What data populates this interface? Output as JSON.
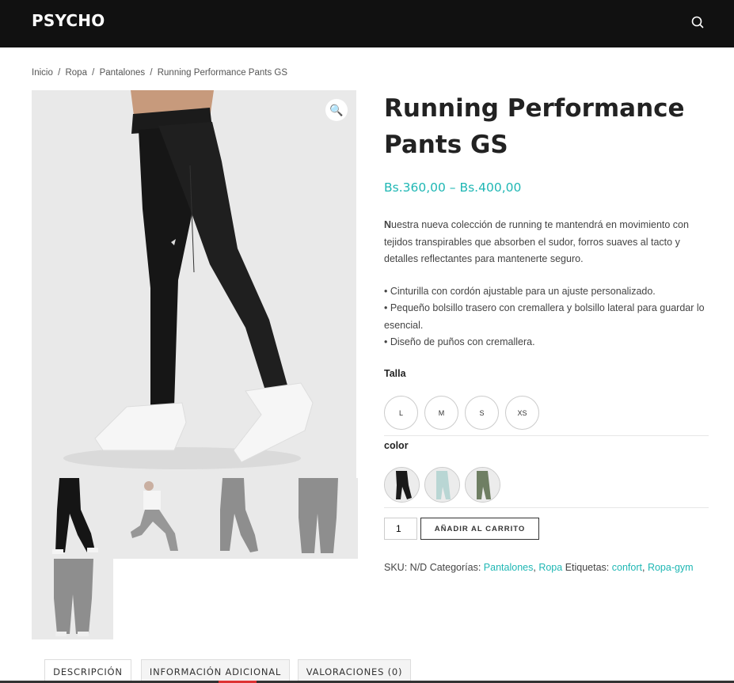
{
  "header": {
    "logo": "PSYCHO",
    "icon": "search-icon"
  },
  "breadcrumb": {
    "items": [
      "Inicio",
      "Ropa",
      "Pantalones",
      "Running Performance Pants GS"
    ],
    "separator": "/"
  },
  "product": {
    "title": "Running Performance Pants GS",
    "price": "Bs.360,00 – Bs.400,00",
    "description": {
      "lead_letter": "N",
      "intro": "uestra nueva colección de running te mantendrá en movimiento con tejidos transpirables que absorben el sudor, forros suaves al tacto y detalles reflectantes para mantenerte seguro.",
      "bullets": [
        "• Cinturilla con cordón ajustable para un ajuste personalizado.",
        "• Pequeño bolsillo trasero con cremallera y bolsillo lateral para guardar lo esencial.",
        "• Diseño de puños con cremallera."
      ]
    },
    "size_label": "Talla",
    "sizes": [
      "L",
      "M",
      "S",
      "XS"
    ],
    "color_label": "color",
    "color_swatches": [
      {
        "name": "negro",
        "color": "#1a1a1a"
      },
      {
        "name": "celeste",
        "color": "#b9d6d4"
      },
      {
        "name": "verde",
        "color": "#6f7f63"
      }
    ],
    "quantity": "1",
    "add_to_cart": "AÑADIR AL CARRITO",
    "meta": {
      "sku_label": "SKU:",
      "sku_value": "N/D",
      "categories_label": "Categorías:",
      "categories": [
        "Pantalones",
        "Ropa"
      ],
      "tags_label": "Etiquetas:",
      "tags": [
        "confort",
        "Ropa-gym"
      ]
    }
  },
  "gallery": {
    "zoom_icon": "🔍",
    "thumbnails": 5
  },
  "tabs": [
    "DESCRIPCIÓN",
    "INFORMACIÓN ADICIONAL",
    "VALORACIONES (0)"
  ],
  "colors": {
    "accent": "#1fb7b4",
    "header_bg": "#111111"
  }
}
